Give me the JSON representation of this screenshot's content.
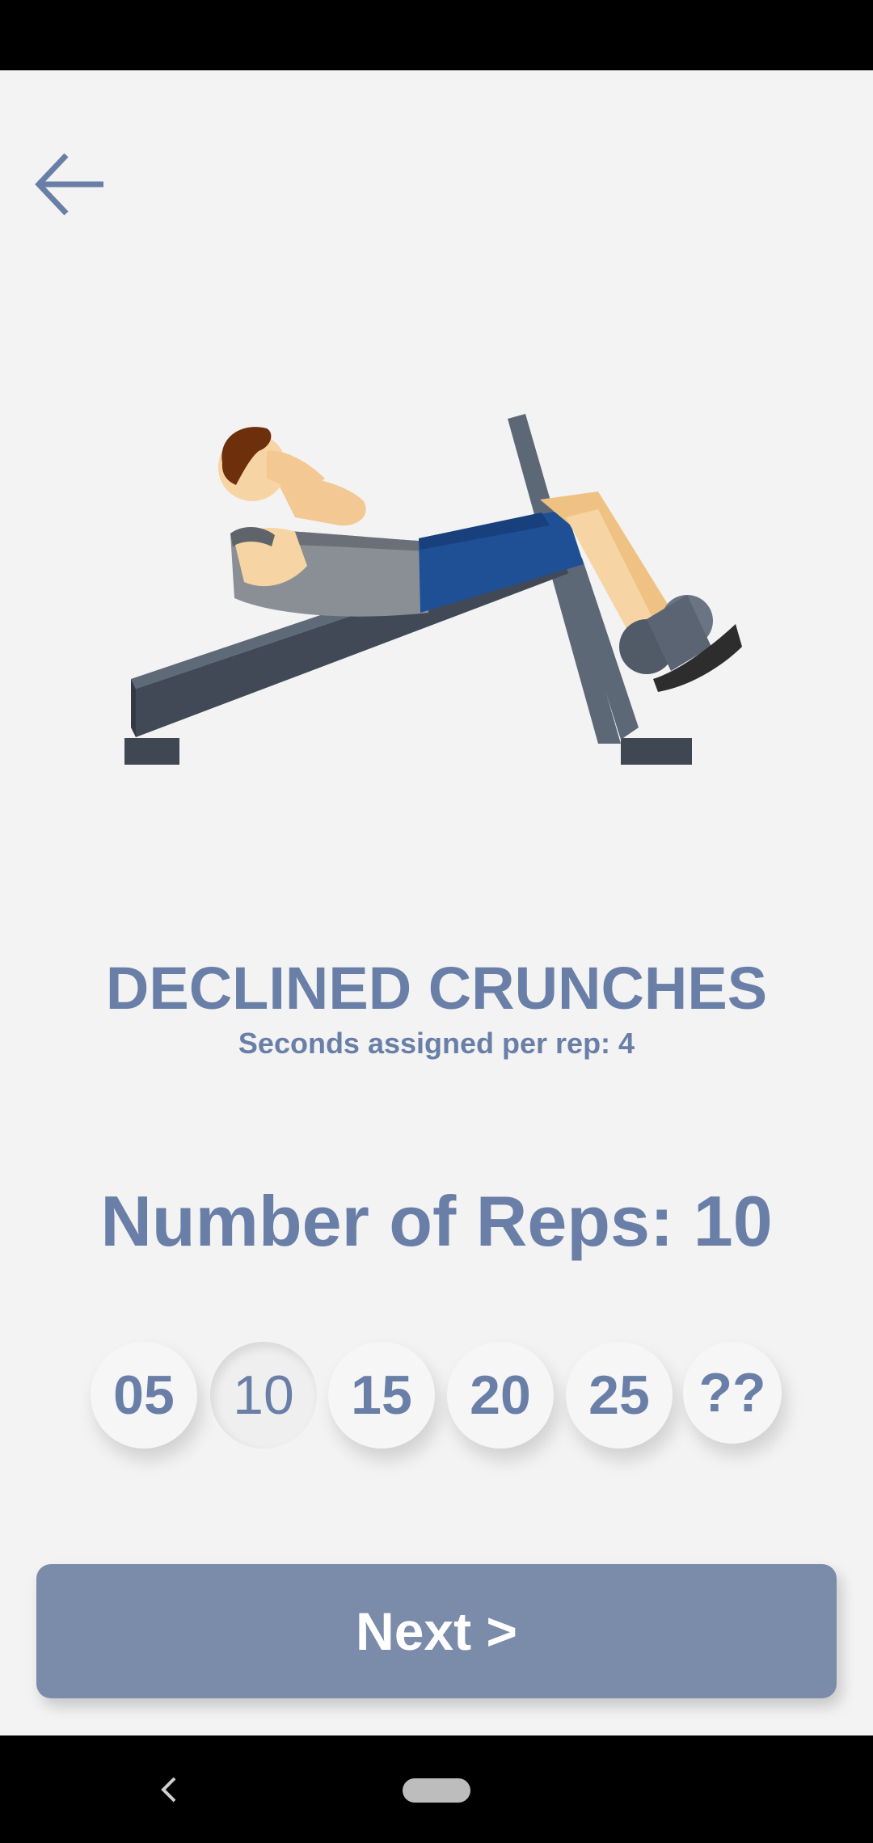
{
  "header": {
    "back_icon": "arrow-left-icon"
  },
  "exercise": {
    "name": "DECLINED CRUNCHES",
    "seconds_per_rep": "Seconds assigned per rep: 4"
  },
  "reps": {
    "label": "Number of Reps: 10",
    "options": [
      "05",
      "10",
      "15",
      "20",
      "25",
      "??"
    ],
    "selected": "10"
  },
  "actions": {
    "next_label": "Next >"
  },
  "colors": {
    "accent": "#6a7fa7",
    "button": "#7a8ca9",
    "background": "#f3f3f3"
  }
}
